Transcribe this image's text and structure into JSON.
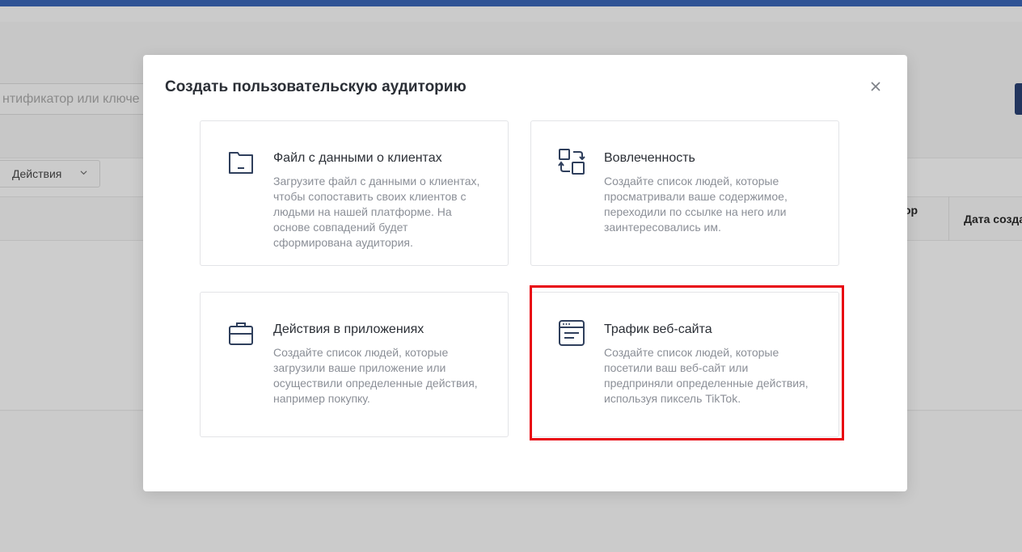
{
  "background": {
    "search_placeholder": "нтификатор или ключе",
    "actions_select": "Действия",
    "table_headers": [
      "ор",
      "Дата созда"
    ]
  },
  "modal": {
    "title": "Создать пользовательскую аудиторию",
    "options": [
      {
        "icon": "folder-icon",
        "title": "Файл с данными о клиентах",
        "description": "Загрузите файл с данными о клиентах, чтобы сопоставить своих клиентов с людьми на нашей платформе. На основе совпадений будет сформирована аудитория."
      },
      {
        "icon": "engagement-icon",
        "title": "Вовлеченность",
        "description": "Создайте список людей, которые просматривали ваше содержимое, переходили по ссылке на него или заинтересовались им."
      },
      {
        "icon": "briefcase-icon",
        "title": "Действия в приложениях",
        "description": "Создайте список людей, которые загрузили ваше приложение или осуществили определенные действия, например покупку."
      },
      {
        "icon": "browser-window-icon",
        "title": "Трафик веб-сайта",
        "description": "Создайте список людей, которые посетили ваш веб-сайт или предприняли определенные действия, используя пиксель TikTok."
      }
    ]
  },
  "colors": {
    "accent": "#2f5395",
    "icon": "#2f3f5c",
    "highlight": "#e8050f"
  }
}
